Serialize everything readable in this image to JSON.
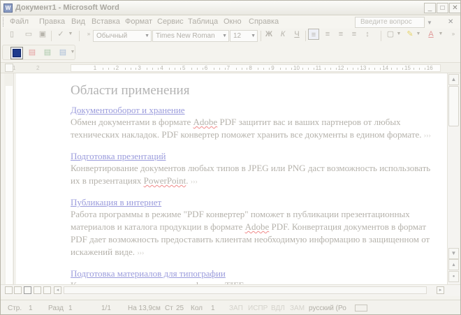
{
  "window": {
    "title": "Документ1 - Microsoft Word"
  },
  "menu": [
    "Файл",
    "Правка",
    "Вид",
    "Вставка",
    "Формат",
    "Сервис",
    "Таблица",
    "Окно",
    "Справка"
  ],
  "help": {
    "placeholder": "Введите вопрос"
  },
  "toolbar": {
    "style": "Обычный",
    "font": "Times New Roman",
    "size": "12",
    "bold": "Ж",
    "italic": "К",
    "underline": "Ч"
  },
  "ruler": {
    "labels": [
      "1",
      "2",
      "1",
      "2",
      "3",
      "4",
      "5",
      "6",
      "7",
      "8",
      "9",
      "10",
      "11",
      "12",
      "13",
      "14",
      "15",
      "16"
    ]
  },
  "document": {
    "heading": "Области применения",
    "sections": [
      {
        "title": "Документооборот и хранение",
        "body_parts": [
          "Обмен документами в формате ",
          "Adobe",
          " PDF защитит вас и ваших партнеров от любых технических накладок. PDF конвертер поможет хранить все документы в едином формате."
        ],
        "more": "›››"
      },
      {
        "title": "Подготовка презентаций",
        "body_parts": [
          "Конвертирование документов любых типов в JPEG или PNG даст возможность использовать их в презентациях ",
          "PowerPoint",
          "."
        ],
        "more": "›››"
      },
      {
        "title": "Публикация в интернет",
        "body_parts": [
          "Работа программы в режиме \"PDF конвертер\" поможет в публикации презентационных материалов и каталога продукции в формате ",
          "Adobe",
          " PDF. Конвертация документов в формат PDF дает возможность предоставить клиентам необходимую информацию в защищенном от искажений виде."
        ],
        "more": "›››"
      },
      {
        "title": "Подготовка материалов для типографии",
        "body_parts": [
          "Конвертирование документов в формат TIFF гарантирует вам высокое качество печати и"
        ],
        "more": ""
      }
    ]
  },
  "status": {
    "page": "Стр.",
    "page_num": "1",
    "section": "Разд",
    "section_num": "1",
    "pages": "1/1",
    "at": "На 13,9см",
    "line": "Ст",
    "line_num": "25",
    "col": "Кол",
    "col_num": "1",
    "rec": "ЗАП",
    "trk": "ИСПР",
    "ext": "ВДЛ",
    "ovr": "ЗАМ",
    "lang": "русский (Ро"
  }
}
